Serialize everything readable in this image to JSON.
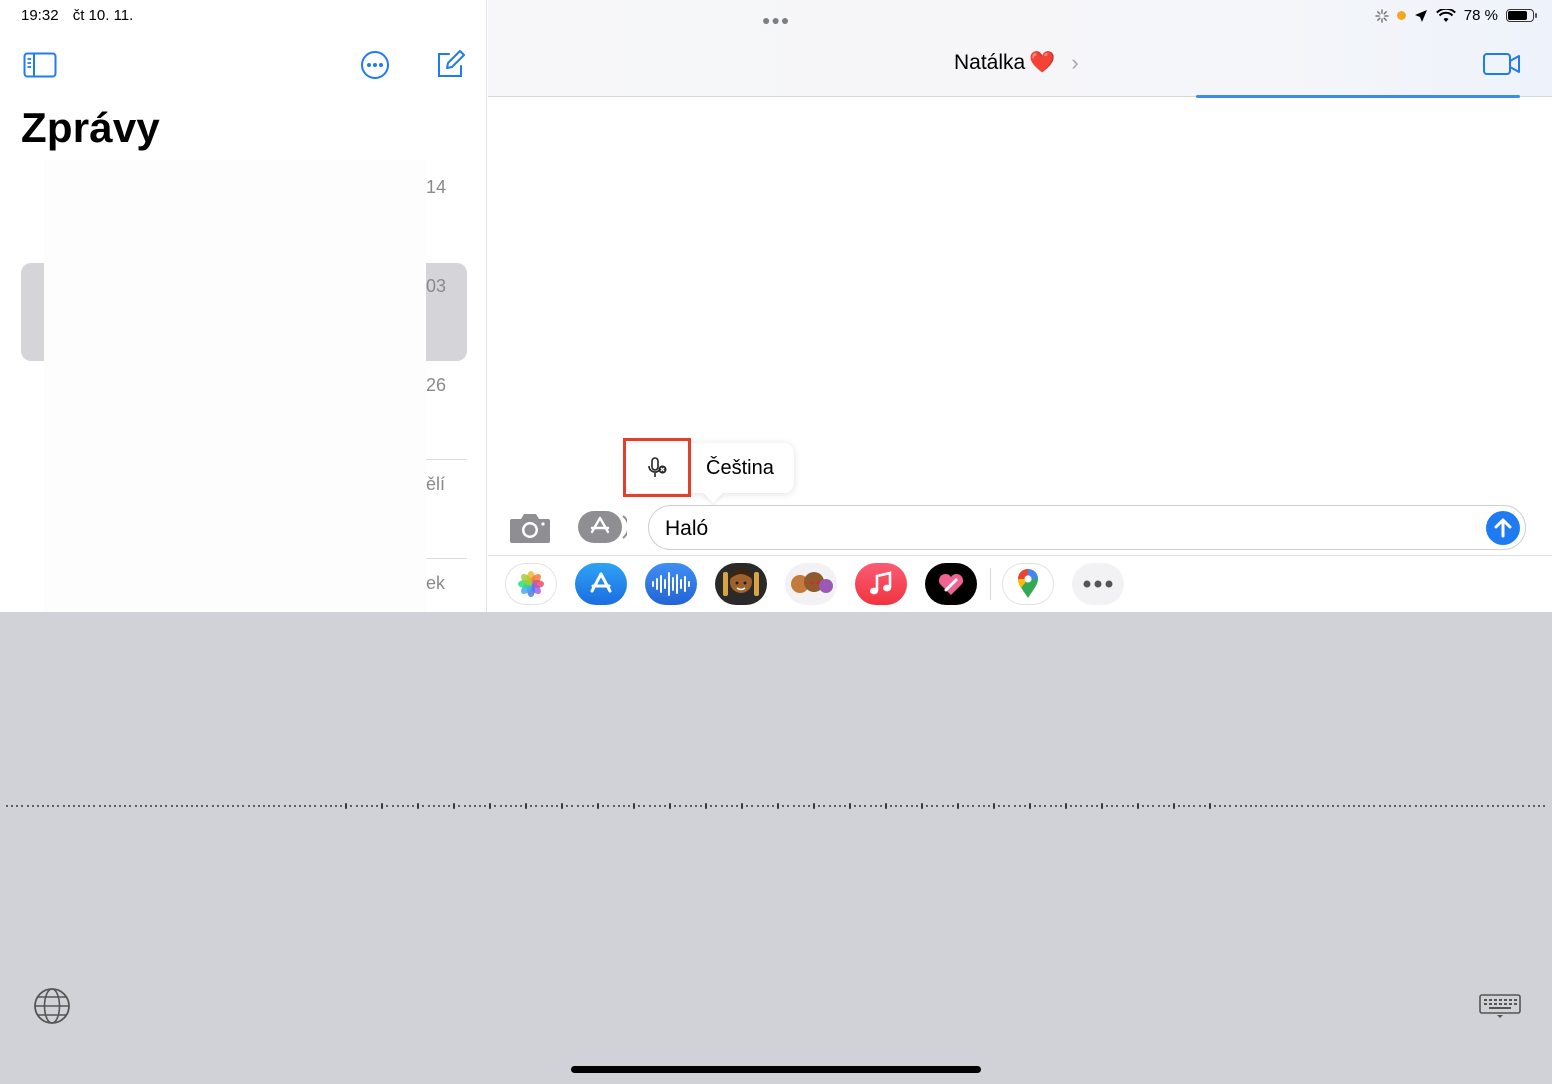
{
  "status_bar": {
    "time": "19:32",
    "date": "čt 10. 11.",
    "battery": "78 %"
  },
  "sidebar": {
    "title": "Zprávy",
    "times": [
      "14",
      "03",
      "26",
      "ělí",
      "ek"
    ]
  },
  "conversation": {
    "contact_name": "Natálka",
    "contact_emoji": "❤️"
  },
  "dictation": {
    "language": "Čeština"
  },
  "compose": {
    "value": "Haló"
  },
  "app_strip": [
    "photos-app",
    "app-store",
    "audio-message",
    "memoji",
    "memoji-stickers",
    "music-app",
    "digital-touch",
    "google-maps",
    "more-apps"
  ],
  "colors": {
    "accent": "#1f7bf2",
    "highlight_box": "#e3402b",
    "keyboard_bg": "#d1d2d7"
  }
}
